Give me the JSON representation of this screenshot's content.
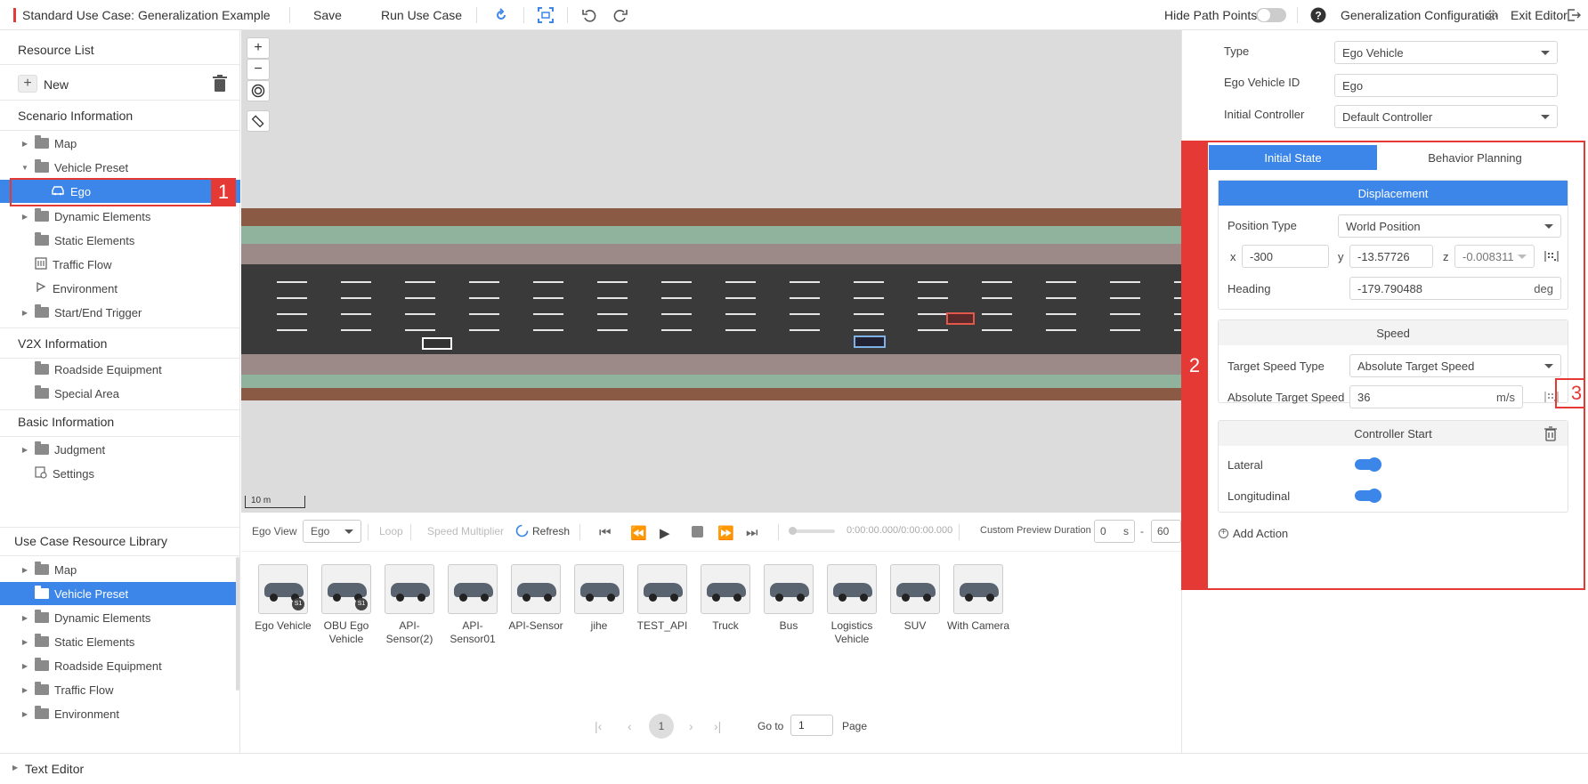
{
  "toolbar": {
    "title": "Standard Use Case: Generalization Example",
    "save": "Save",
    "run": "Run Use Case",
    "hide_path_points": "Hide Path Points",
    "hide_path_points_on": false,
    "generalization_config": "Generalization Configuration",
    "exit_editor": "Exit Editor"
  },
  "resource": {
    "title": "Resource List",
    "new_label": "New",
    "scenario_title": "Scenario Information",
    "scenario_items": [
      {
        "label": "Map"
      },
      {
        "label": "Vehicle Preset"
      },
      {
        "label": "Ego"
      },
      {
        "label": "Dynamic Elements"
      },
      {
        "label": "Static Elements"
      },
      {
        "label": "Traffic Flow"
      },
      {
        "label": "Environment"
      },
      {
        "label": "Start/End Trigger"
      }
    ],
    "v2x_title": "V2X Information",
    "v2x_items": [
      {
        "label": "Roadside Equipment"
      },
      {
        "label": "Special Area"
      }
    ],
    "basic_title": "Basic Information",
    "basic_items": [
      {
        "label": "Judgment"
      },
      {
        "label": "Settings"
      }
    ]
  },
  "library_tree": {
    "title": "Use Case Resource Library",
    "items": [
      {
        "label": "Map"
      },
      {
        "label": "Vehicle Preset"
      },
      {
        "label": "Dynamic Elements"
      },
      {
        "label": "Static Elements"
      },
      {
        "label": "Roadside Equipment"
      },
      {
        "label": "Traffic Flow"
      },
      {
        "label": "Environment"
      }
    ]
  },
  "annotations": {
    "n1": "1",
    "n2": "2",
    "n3": "3"
  },
  "canvas": {
    "scale": "10 m"
  },
  "playbar": {
    "ego_view_label": "Ego View",
    "ego_view_value": "Ego",
    "loop": "Loop",
    "speed_multiplier": "Speed Multiplier",
    "refresh": "Refresh",
    "time": "0:00:00.000/0:00:00.000",
    "custom_preview": "Custom Preview Duration",
    "start_value": "0",
    "unit": "s",
    "dash": "-",
    "end_value": "60"
  },
  "vehicles": [
    {
      "name": "Ego Vehicle",
      "badge": "S1"
    },
    {
      "name": "OBU Ego Vehicle",
      "badge": "S1"
    },
    {
      "name": "API-Sensor(2)",
      "badge": ""
    },
    {
      "name": "API-Sensor01",
      "badge": ""
    },
    {
      "name": "API-Sensor",
      "badge": ""
    },
    {
      "name": "jihe",
      "badge": ""
    },
    {
      "name": "TEST_API",
      "badge": ""
    },
    {
      "name": "Truck",
      "badge": ""
    },
    {
      "name": "Bus",
      "badge": ""
    },
    {
      "name": "Logistics Vehicle",
      "badge": ""
    },
    {
      "name": "SUV",
      "badge": ""
    },
    {
      "name": "With Camera",
      "badge": ""
    }
  ],
  "pagination": {
    "current": "1",
    "goto_label": "Go to",
    "goto_value": "1",
    "page_label": "Page"
  },
  "text_editor": "Text Editor",
  "props": {
    "type_label": "Type",
    "type_value": "Ego Vehicle",
    "id_label": "Ego Vehicle ID",
    "id_value": "Ego",
    "controller_label": "Initial Controller",
    "controller_value": "Default Controller",
    "tab_initial": "Initial State",
    "tab_behavior": "Behavior Planning",
    "displacement": "Displacement",
    "position_type_label": "Position Type",
    "position_type_value": "World Position",
    "x_label": "x",
    "x_value": "-300",
    "y_label": "y",
    "y_value": "-13.57726",
    "z_label": "z",
    "z_value": "-0.008311",
    "heading_label": "Heading",
    "heading_value": "-179.790488",
    "heading_unit": "deg",
    "speed_title": "Speed",
    "target_speed_type_label": "Target Speed Type",
    "target_speed_type_value": "Absolute Target Speed",
    "abs_speed_label": "Absolute Target Speed",
    "abs_speed_value": "36",
    "abs_speed_unit": "m/s",
    "controller_start": "Controller Start",
    "lateral": "Lateral",
    "longitudinal": "Longitudinal",
    "lateral_on": true,
    "longitudinal_on": true,
    "add_action": "Add Action"
  }
}
